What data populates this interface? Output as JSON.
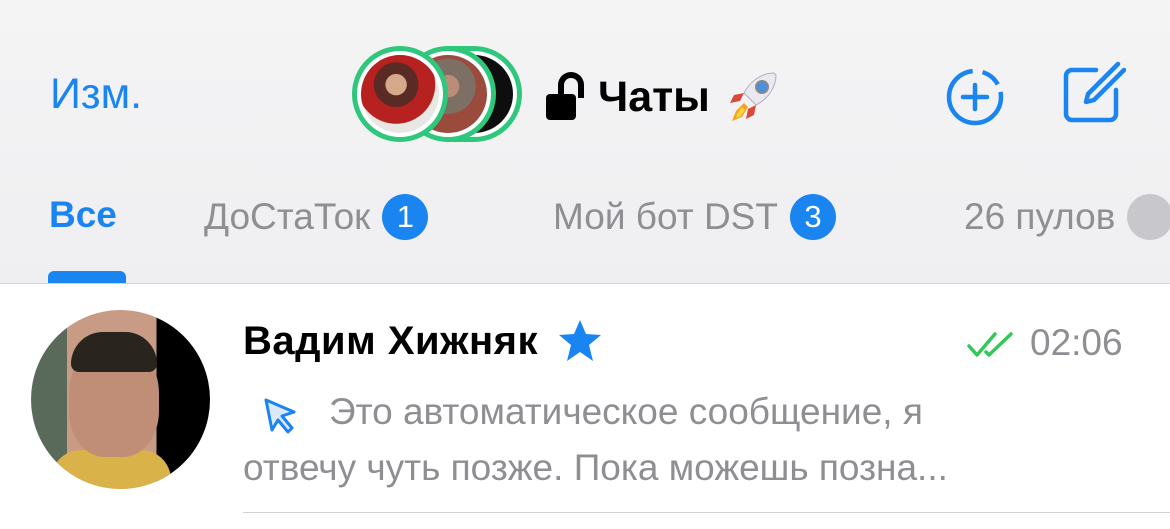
{
  "header": {
    "edit_label": "Изм.",
    "title": "Чаты",
    "stories": [
      {
        "name": "story-avatar-1"
      },
      {
        "name": "story-avatar-2"
      },
      {
        "name": "story-avatar-3"
      }
    ],
    "icons": {
      "lock": "unlocked-lock-icon",
      "rocket": "rocket-icon",
      "new_story": "plus-circle-dashed-icon",
      "compose": "compose-icon"
    },
    "accent_color": "#1a84f0",
    "story_ring_color": "#2fc77b"
  },
  "tabs": [
    {
      "label": "Все",
      "active": true
    },
    {
      "label": "ДоСтаТок",
      "badge": "1"
    },
    {
      "label": "Мой бот DST",
      "badge": "3"
    },
    {
      "label": "26 пулов",
      "badge": ""
    }
  ],
  "chats": [
    {
      "name": "Вадим Хижняк",
      "verified_icon": "star-icon",
      "read_status": "double-check-icon",
      "read_color": "#34c759",
      "time": "02:06",
      "preview_line1": "Это автоматическое сообщение, я",
      "preview_line2": "отвечу чуть позже. Пока можешь позна..."
    }
  ]
}
